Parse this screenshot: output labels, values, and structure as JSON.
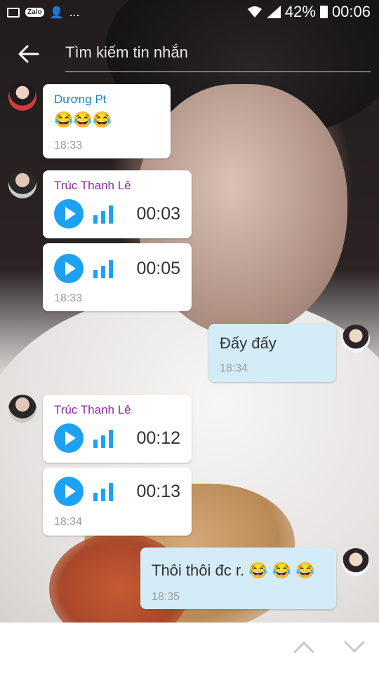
{
  "status_bar": {
    "battery": "42%",
    "time": "00:06",
    "zalo_label": "Zalo",
    "more": "..."
  },
  "search": {
    "placeholder": "Tìm kiếm tin nhắn"
  },
  "messages": [
    {
      "sender": "Dương Pt",
      "text": "😂😂😂",
      "time": "18:33"
    },
    {
      "sender": "Trúc Thanh Lê",
      "duration": "00:03"
    },
    {
      "duration": "00:05",
      "time": "18:33"
    },
    {
      "text": "Đấy đấy",
      "time": "18:34"
    },
    {
      "sender": "Trúc Thanh Lê",
      "duration": "00:12"
    },
    {
      "duration": "00:13",
      "time": "18:34"
    },
    {
      "text": "Thôi thôi đc r. 😂 😂 😂",
      "time": "18:35"
    }
  ],
  "colors": {
    "accent": "#1da1f2",
    "sent_bubble": "#d4ecf8",
    "sender_blue": "#1b82c4",
    "sender_purple": "#8b2aa0"
  },
  "icons": [
    "back-arrow-icon",
    "play-icon",
    "waveform-icon",
    "chevron-up-icon",
    "chevron-down-icon",
    "wifi-icon",
    "signal-icon",
    "battery-icon"
  ]
}
